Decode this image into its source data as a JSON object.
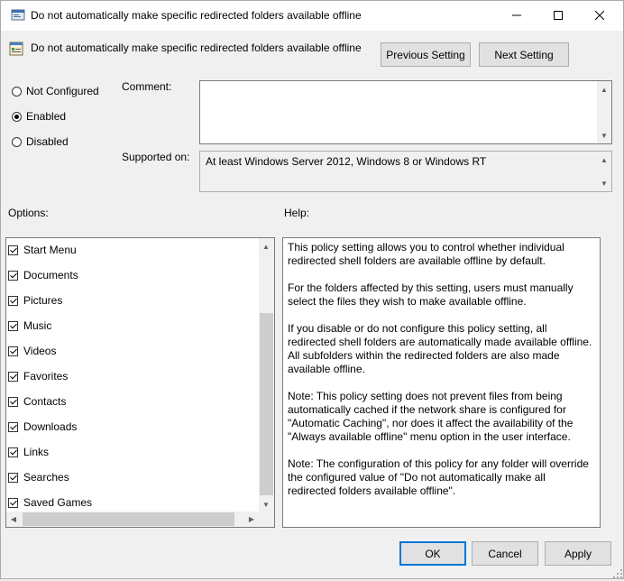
{
  "window": {
    "title": "Do not automatically make specific redirected folders available offline"
  },
  "header": {
    "setting_name": "Do not automatically make specific redirected folders available offline",
    "prev_label": "Previous Setting",
    "next_label": "Next Setting"
  },
  "state": {
    "options": [
      {
        "label": "Not Configured",
        "selected": false
      },
      {
        "label": "Enabled",
        "selected": true
      },
      {
        "label": "Disabled",
        "selected": false
      }
    ]
  },
  "comment": {
    "label": "Comment:",
    "value": ""
  },
  "supported": {
    "label": "Supported on:",
    "value": "At least Windows Server 2012, Windows 8 or Windows RT"
  },
  "options_panel": {
    "label": "Options:",
    "items": [
      {
        "label": "Start Menu",
        "checked": true
      },
      {
        "label": "Documents",
        "checked": true
      },
      {
        "label": "Pictures",
        "checked": true
      },
      {
        "label": "Music",
        "checked": true
      },
      {
        "label": "Videos",
        "checked": true
      },
      {
        "label": "Favorites",
        "checked": true
      },
      {
        "label": "Contacts",
        "checked": true
      },
      {
        "label": "Downloads",
        "checked": true
      },
      {
        "label": "Links",
        "checked": true
      },
      {
        "label": "Searches",
        "checked": true
      },
      {
        "label": "Saved Games",
        "checked": true
      }
    ]
  },
  "help_panel": {
    "label": "Help:",
    "paragraphs": [
      "This policy setting allows you to control whether individual redirected shell folders are available offline by default.",
      "For the folders affected by this setting, users must manually select the files they wish to make available offline.",
      "If you disable or do not configure this policy setting, all redirected shell folders are automatically made available offline. All subfolders within the redirected folders are also made available offline.",
      "Note: This policy setting does not prevent files from being automatically cached if the network share is configured for \"Automatic Caching\", nor does it affect the availability of the \"Always available offline\" menu option in the user interface.",
      "Note: The configuration of this policy for any folder will override the configured value of \"Do not automatically make all redirected folders available offline\"."
    ]
  },
  "footer": {
    "ok_label": "OK",
    "cancel_label": "Cancel",
    "apply_label": "Apply"
  }
}
